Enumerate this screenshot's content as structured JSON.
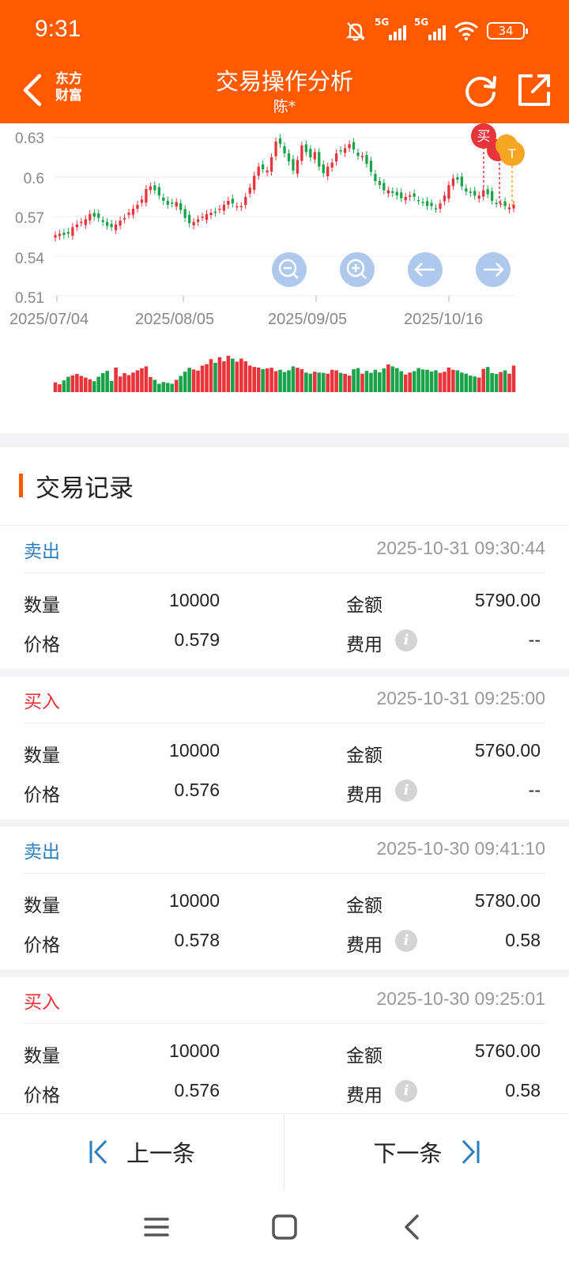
{
  "status_bar": {
    "time": "9:31",
    "network1": "5G",
    "network2": "5G",
    "battery": "34"
  },
  "header": {
    "logo_line1": "东方",
    "logo_line2": "财富",
    "title": "交易操作分析",
    "subtitle": "陈*"
  },
  "chart": {
    "y_ticks": [
      "0.63",
      "0.6",
      "0.57",
      "0.54",
      "0.51"
    ],
    "x_ticks": [
      "2025/07/04",
      "2025/08/05",
      "2025/09/05",
      "2025/10/16"
    ],
    "markers": {
      "buy": "买",
      "t": "T"
    },
    "colors": {
      "up": "#e8343a",
      "down": "#1aa34a",
      "accent": "#ff5a00",
      "control": "#aec9ec"
    }
  },
  "chart_data": {
    "type": "candlestick",
    "ylim": [
      0.51,
      0.63
    ],
    "x_tick_labels": [
      "2025/07/04",
      "2025/08/05",
      "2025/09/05",
      "2025/10/16"
    ],
    "y_tick_labels": [
      0.63,
      0.6,
      0.57,
      0.54,
      0.51
    ],
    "close": [
      0.556,
      0.557,
      0.556,
      0.557,
      0.562,
      0.564,
      0.566,
      0.568,
      0.572,
      0.57,
      0.569,
      0.566,
      0.563,
      0.562,
      0.564,
      0.567,
      0.569,
      0.573,
      0.576,
      0.579,
      0.583,
      0.591,
      0.593,
      0.59,
      0.586,
      0.582,
      0.579,
      0.58,
      0.581,
      0.575,
      0.569,
      0.565,
      0.566,
      0.568,
      0.57,
      0.572,
      0.573,
      0.573,
      0.576,
      0.579,
      0.582,
      0.58,
      0.578,
      0.578,
      0.585,
      0.592,
      0.601,
      0.608,
      0.606,
      0.605,
      0.615,
      0.627,
      0.625,
      0.618,
      0.612,
      0.605,
      0.613,
      0.624,
      0.619,
      0.615,
      0.619,
      0.608,
      0.603,
      0.608,
      0.611,
      0.618,
      0.62,
      0.622,
      0.625,
      0.621,
      0.616,
      0.616,
      0.61,
      0.604,
      0.597,
      0.594,
      0.59,
      0.59,
      0.588,
      0.586,
      0.584,
      0.585,
      0.586,
      0.585,
      0.582,
      0.581,
      0.578,
      0.578,
      0.576,
      0.58,
      0.586,
      0.594,
      0.599,
      0.598,
      0.593,
      0.589,
      0.588,
      0.586,
      0.586,
      0.59,
      0.587,
      0.582,
      0.58,
      0.58,
      0.578,
      0.577,
      0.579
    ],
    "volume": [
      0.35,
      0.28,
      0.42,
      0.55,
      0.6,
      0.65,
      0.58,
      0.52,
      0.46,
      0.39,
      0.55,
      0.68,
      0.76,
      0.4,
      0.88,
      0.56,
      0.68,
      0.61,
      0.7,
      0.78,
      0.85,
      0.92,
      0.54,
      0.44,
      0.3,
      0.36,
      0.33,
      0.3,
      0.44,
      0.58,
      0.73,
      0.87,
      0.81,
      0.77,
      0.95,
      1.0,
      1.18,
      1.05,
      1.25,
      1.1,
      1.3,
      1.2,
      1.09,
      1.2,
      1.1,
      0.95,
      0.9,
      0.88,
      0.82,
      0.85,
      0.87,
      0.75,
      0.8,
      0.72,
      0.78,
      0.92,
      0.87,
      0.82,
      0.7,
      0.66,
      0.73,
      0.7,
      0.69,
      0.66,
      0.8,
      0.78,
      0.69,
      0.65,
      0.59,
      0.82,
      0.86,
      0.66,
      0.76,
      0.69,
      0.8,
      0.71,
      0.85,
      0.99,
      0.92,
      0.86,
      0.75,
      0.63,
      0.7,
      0.75,
      0.86,
      0.81,
      0.8,
      0.74,
      0.78,
      0.69,
      0.73,
      0.88,
      0.8,
      0.78,
      0.7,
      0.66,
      0.59,
      0.56,
      0.52,
      0.83,
      0.9,
      0.68,
      0.65,
      0.72,
      0.78,
      0.66,
      0.95
    ]
  },
  "records": {
    "section_title": "交易记录",
    "labels": {
      "qty": "数量",
      "amount": "金额",
      "price": "价格",
      "fee": "费用"
    },
    "items": [
      {
        "type": "卖出",
        "time": "2025-10-31 09:30:44",
        "qty": "10000",
        "amount": "5790.00",
        "price": "0.579",
        "fee": "--"
      },
      {
        "type": "买入",
        "time": "2025-10-31 09:25:00",
        "qty": "10000",
        "amount": "5760.00",
        "price": "0.576",
        "fee": "--"
      },
      {
        "type": "卖出",
        "time": "2025-10-30 09:41:10",
        "qty": "10000",
        "amount": "5780.00",
        "price": "0.578",
        "fee": "0.58"
      },
      {
        "type": "买入",
        "time": "2025-10-30 09:25:01",
        "qty": "10000",
        "amount": "5760.00",
        "price": "0.576",
        "fee": "0.58"
      }
    ]
  },
  "pager": {
    "prev": "上一条",
    "next": "下一条"
  }
}
